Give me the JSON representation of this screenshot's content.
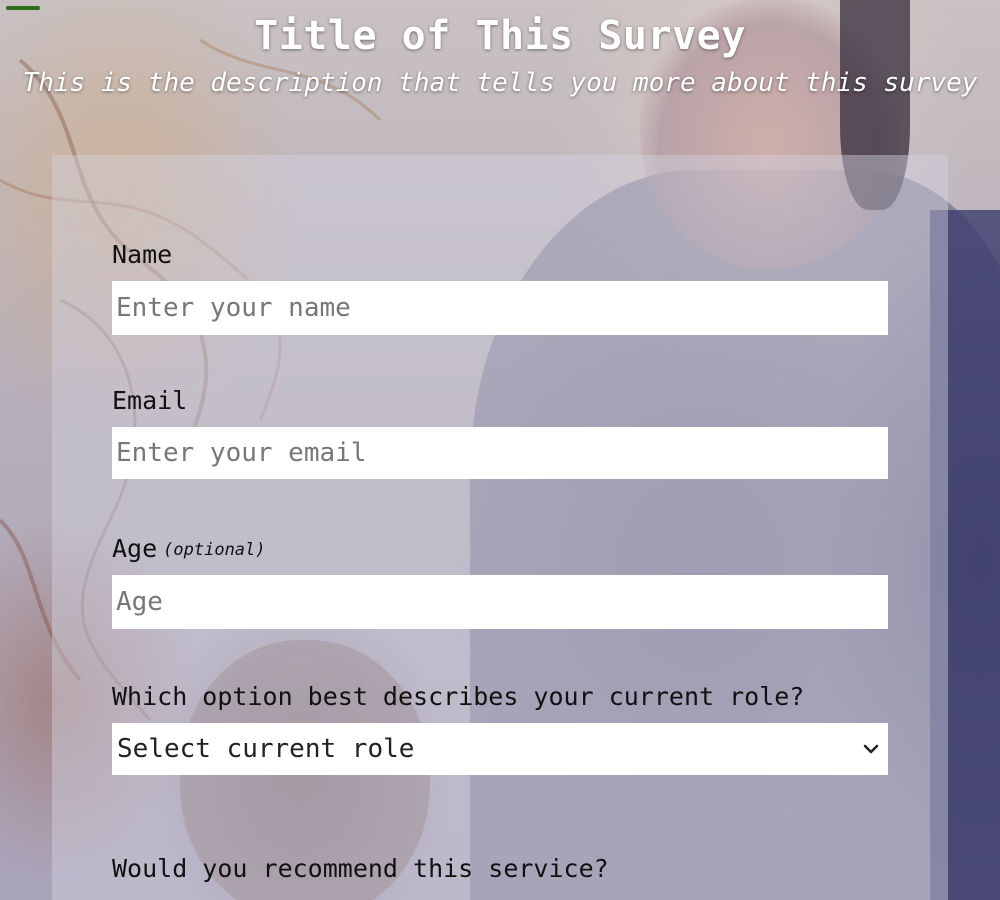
{
  "header": {
    "title": "Title of This Survey",
    "description": "This is the description that tells you more about this survey"
  },
  "form": {
    "name": {
      "label": "Name",
      "placeholder": "Enter your name"
    },
    "email": {
      "label": "Email",
      "placeholder": "Enter your email"
    },
    "age": {
      "label": "Age",
      "optional_note": "(optional)",
      "placeholder": "Age"
    },
    "role": {
      "label": "Which option best describes your current role?",
      "selected": "Select current role",
      "icon": "chevron-down-icon"
    },
    "recommend": {
      "label": "Would you recommend this service?"
    }
  },
  "colors": {
    "title_text": "#ffffff",
    "label_text": "#111111",
    "input_background": "#ffffff",
    "top_mark": "#2e6e1a"
  }
}
